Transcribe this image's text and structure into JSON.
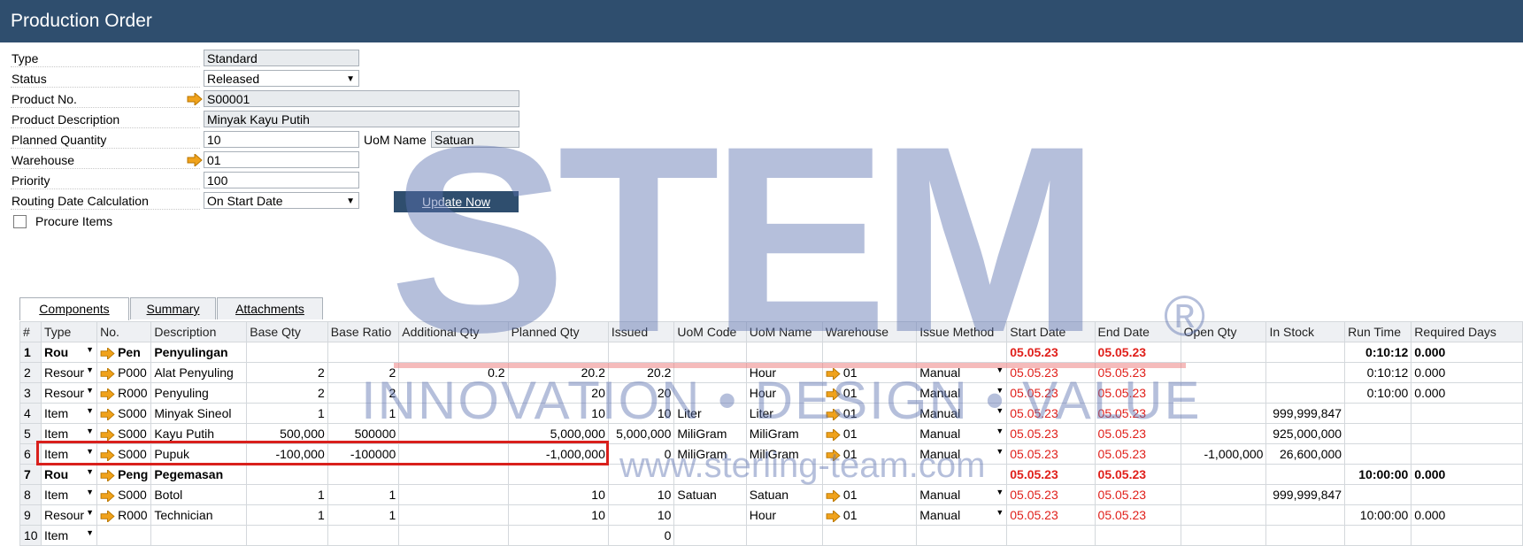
{
  "window": {
    "title": "Production Order"
  },
  "header": {
    "type_label": "Type",
    "type_value": "Standard",
    "status_label": "Status",
    "status_value": "Released",
    "product_no_label": "Product No.",
    "product_no_value": "S00001",
    "product_desc_label": "Product Description",
    "product_desc_value": "Minyak Kayu Putih",
    "planned_qty_label": "Planned Quantity",
    "planned_qty_value": "10",
    "uom_name_label": "UoM Name",
    "uom_name_value": "Satuan",
    "warehouse_label": "Warehouse",
    "warehouse_value": "01",
    "priority_label": "Priority",
    "priority_value": "100",
    "routing_label": "Routing Date Calculation",
    "routing_value": "On Start Date",
    "update_now_label": "Update Now",
    "procure_items_label": "Procure Items"
  },
  "tabs": [
    {
      "label": "Components",
      "active": true
    },
    {
      "label": "Summary",
      "active": false
    },
    {
      "label": "Attachments",
      "active": false
    }
  ],
  "grid": {
    "columns": [
      "#",
      "Type",
      "No.",
      "Description",
      "Base Qty",
      "Base Ratio",
      "Additional Qty",
      "Planned Qty",
      "Issued",
      "UoM Code",
      "UoM Name",
      "Warehouse",
      "Issue Method",
      "Start Date",
      "End Date",
      "Open Qty",
      "In Stock",
      "Run Time",
      "Required Days"
    ],
    "rows": [
      {
        "n": "1",
        "type": "Rou",
        "no": "Pen",
        "desc": "Penyulingan",
        "base_qty": "",
        "base_ratio": "",
        "add_qty": "",
        "planned": "",
        "issued": "",
        "uom_code": "",
        "uom_name": "",
        "wh": "",
        "method": "",
        "start": "05.05.23",
        "end": "05.05.23",
        "open": "",
        "stock": "",
        "run": "0:10:12",
        "days": "0.000",
        "route": true
      },
      {
        "n": "2",
        "type": "Resour",
        "no": "P000",
        "desc": "Alat Penyuling",
        "base_qty": "2",
        "base_ratio": "2",
        "add_qty": "0.2",
        "planned": "20.2",
        "issued": "20.2",
        "uom_code": "",
        "uom_name": "Hour",
        "wh": "01",
        "method": "Manual",
        "start": "05.05.23",
        "end": "05.05.23",
        "open": "",
        "stock": "",
        "run": "0:10:12",
        "days": "0.000"
      },
      {
        "n": "3",
        "type": "Resour",
        "no": "R000",
        "desc": "Penyuling",
        "base_qty": "2",
        "base_ratio": "2",
        "add_qty": "",
        "planned": "20",
        "issued": "20",
        "uom_code": "",
        "uom_name": "Hour",
        "wh": "01",
        "method": "Manual",
        "start": "05.05.23",
        "end": "05.05.23",
        "open": "",
        "stock": "",
        "run": "0:10:00",
        "days": "0.000"
      },
      {
        "n": "4",
        "type": "Item",
        "no": "S000",
        "desc": "Minyak Sineol",
        "base_qty": "1",
        "base_ratio": "1",
        "add_qty": "",
        "planned": "10",
        "issued": "10",
        "uom_code": "Liter",
        "uom_name": "Liter",
        "wh": "01",
        "method": "Manual",
        "start": "05.05.23",
        "end": "05.05.23",
        "open": "",
        "stock": "999,999,847",
        "run": "",
        "days": ""
      },
      {
        "n": "5",
        "type": "Item",
        "no": "S000",
        "desc": "Kayu Putih",
        "base_qty": "500,000",
        "base_ratio": "500000",
        "add_qty": "",
        "planned": "5,000,000",
        "issued": "5,000,000",
        "uom_code": "MiliGram",
        "uom_name": "MiliGram",
        "wh": "01",
        "method": "Manual",
        "start": "05.05.23",
        "end": "05.05.23",
        "open": "",
        "stock": "925,000,000",
        "run": "",
        "days": ""
      },
      {
        "n": "6",
        "type": "Item",
        "no": "S000",
        "desc": "Pupuk",
        "base_qty": "-100,000",
        "base_ratio": "-100000",
        "add_qty": "",
        "planned": "-1,000,000",
        "issued": "0",
        "uom_code": "MiliGram",
        "uom_name": "MiliGram",
        "wh": "01",
        "method": "Manual",
        "start": "05.05.23",
        "end": "05.05.23",
        "open": "-1,000,000",
        "stock": "26,600,000",
        "run": "",
        "days": ""
      },
      {
        "n": "7",
        "type": "Rou",
        "no": "Peng",
        "desc": "Pegemasan",
        "base_qty": "",
        "base_ratio": "",
        "add_qty": "",
        "planned": "",
        "issued": "",
        "uom_code": "",
        "uom_name": "",
        "wh": "",
        "method": "",
        "start": "05.05.23",
        "end": "05.05.23",
        "open": "",
        "stock": "",
        "run": "10:00:00",
        "days": "0.000",
        "route": true
      },
      {
        "n": "8",
        "type": "Item",
        "no": "S000",
        "desc": "Botol",
        "base_qty": "1",
        "base_ratio": "1",
        "add_qty": "",
        "planned": "10",
        "issued": "10",
        "uom_code": "Satuan",
        "uom_name": "Satuan",
        "wh": "01",
        "method": "Manual",
        "start": "05.05.23",
        "end": "05.05.23",
        "open": "",
        "stock": "999,999,847",
        "run": "",
        "days": ""
      },
      {
        "n": "9",
        "type": "Resour",
        "no": "R000",
        "desc": "Technician",
        "base_qty": "1",
        "base_ratio": "1",
        "add_qty": "",
        "planned": "10",
        "issued": "10",
        "uom_code": "",
        "uom_name": "Hour",
        "wh": "01",
        "method": "Manual",
        "start": "05.05.23",
        "end": "05.05.23",
        "open": "",
        "stock": "",
        "run": "10:00:00",
        "days": "0.000"
      },
      {
        "n": "10",
        "type": "Item",
        "no": "",
        "desc": "",
        "base_qty": "",
        "base_ratio": "",
        "add_qty": "",
        "planned": "",
        "issued": "0",
        "uom_code": "",
        "uom_name": "",
        "wh": "",
        "method": "",
        "start": "",
        "end": "",
        "open": "",
        "stock": "",
        "run": "",
        "days": ""
      }
    ]
  },
  "watermark": {
    "logo": "STEM",
    "registered": "®",
    "tagline": "INNOVATION • DESIGN • VALUE",
    "url": "www.sterling-team.com"
  },
  "colors": {
    "title_bar": "#2f4e6e",
    "date_red": "#e0201b",
    "link_arrow": "#f0a21b",
    "highlight_box": "#d9201c"
  },
  "icons": {
    "link_arrow": "arrow-right-icon",
    "dropdown": "chevron-down-icon"
  }
}
